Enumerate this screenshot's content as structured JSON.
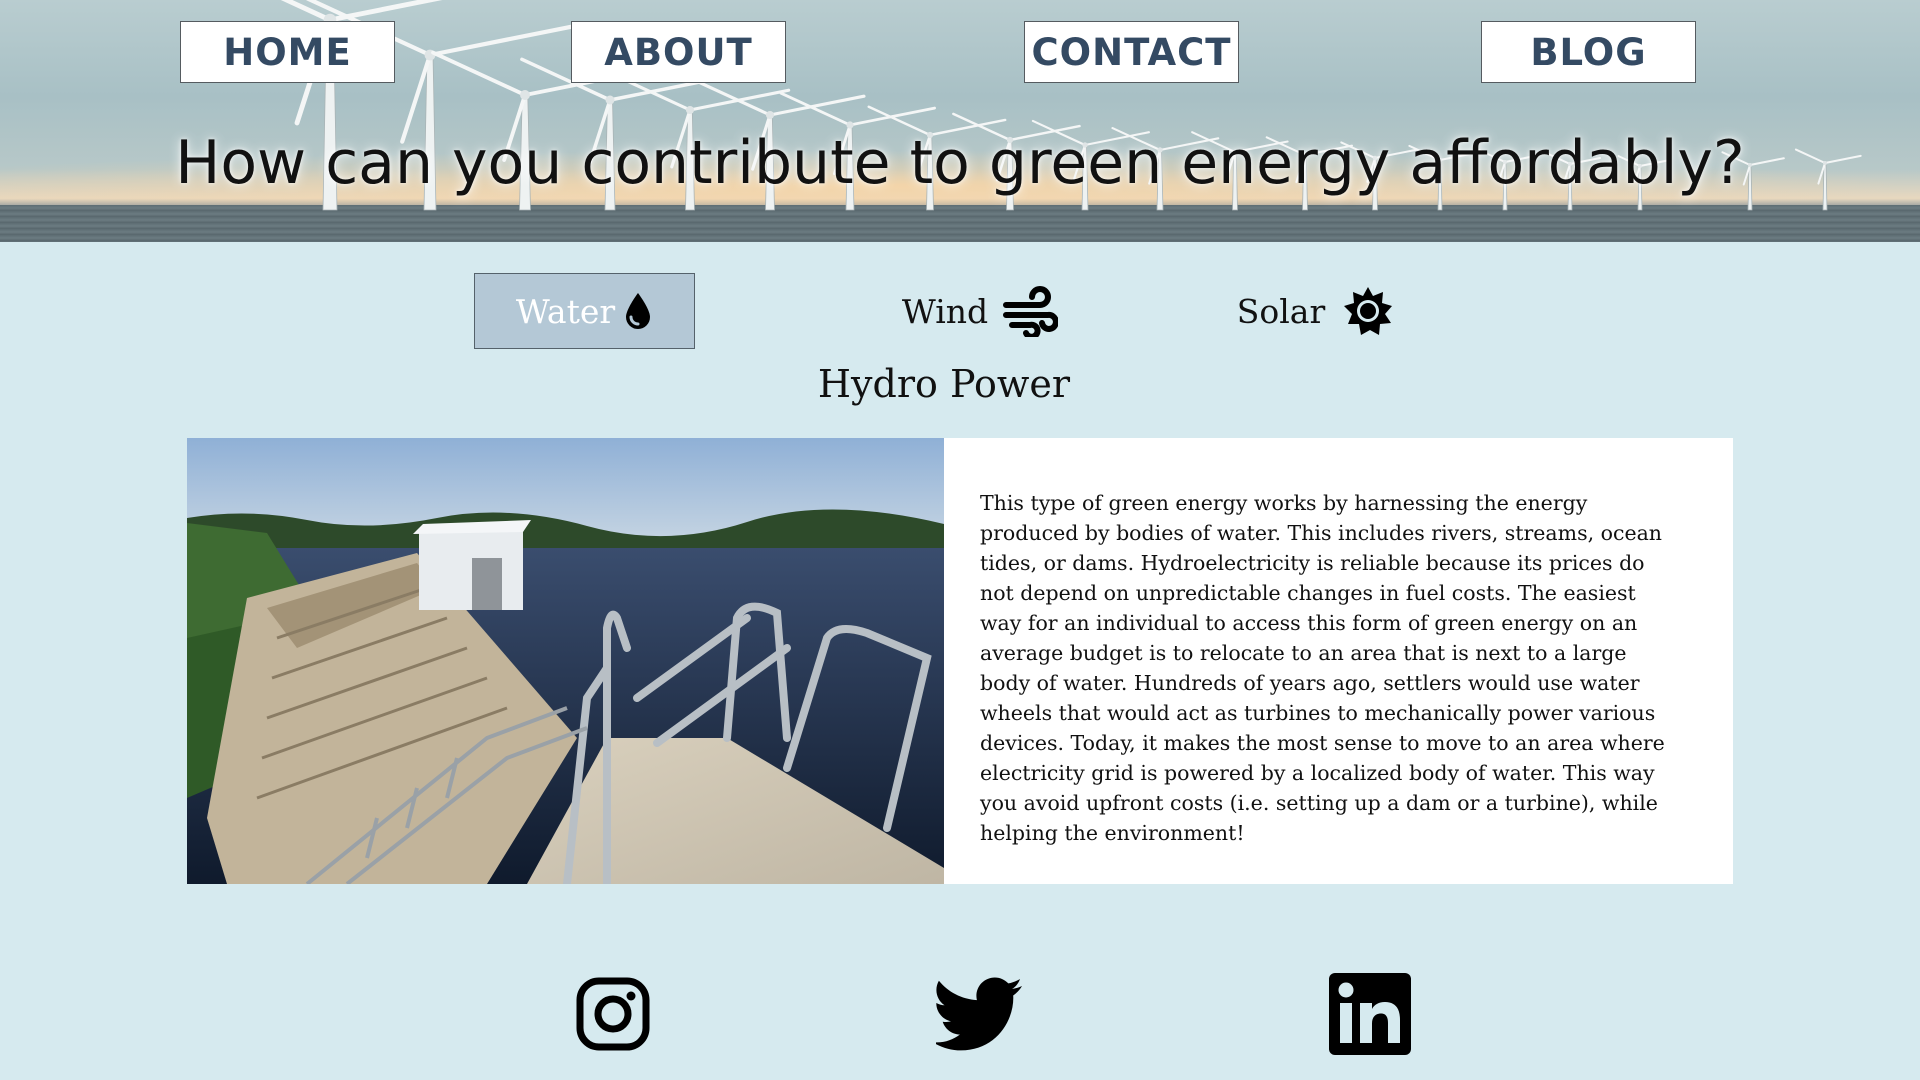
{
  "nav": {
    "home": "HOME",
    "about": "ABOUT",
    "contact": "CONTACT",
    "blog": "BLOG"
  },
  "hero": {
    "title": "How can you contribute to green energy affordably?"
  },
  "tabs": [
    {
      "label": "Water",
      "icon": "water-drop-icon",
      "active": true
    },
    {
      "label": "Wind",
      "icon": "wind-icon",
      "active": false
    },
    {
      "label": "Solar",
      "icon": "sun-icon",
      "active": false
    }
  ],
  "section": {
    "title": "Hydro Power",
    "body": "This type of green energy works by harnessing the energy produced by bodies of water. This includes rivers, streams, ocean tides, or dams. Hydroelectricity is reliable because its prices do not depend on unpredictable changes in fuel costs. The easiest way for an individual to access this form of green energy on an average budget is to relocate to an area that is next to a large body of water. Hundreds of years ago, settlers would use water wheels that would act as turbines to mechanically power various devices. Today, it makes the most sense to move to an area where electricity grid is powered by a localized body of water. This way you avoid upfront costs (i.e. setting up a dam or a turbine), while helping the environment!"
  },
  "social": [
    "instagram-icon",
    "twitter-icon",
    "linkedin-icon"
  ],
  "colors": {
    "page_bg": "#d6eaef",
    "nav_text": "#344a63",
    "active_tab_bg": "#b4c8d6",
    "card_bg": "#ffffff"
  }
}
